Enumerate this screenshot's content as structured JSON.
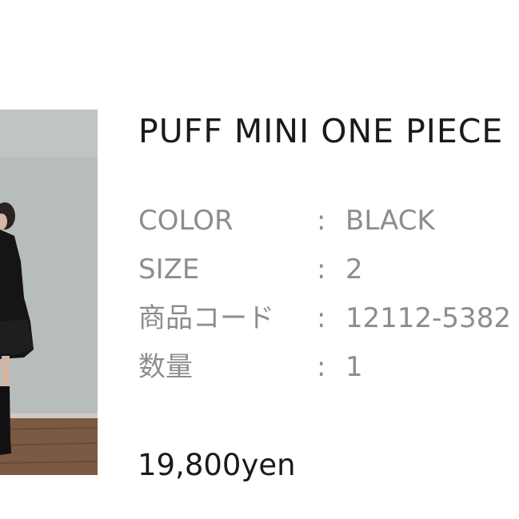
{
  "product": {
    "title": "PUFF MINI ONE PIECE",
    "price": "19,800yen",
    "image_alt": "model-wearing-black-dress"
  },
  "specs": [
    {
      "label": "COLOR",
      "colon": ":",
      "value": "BLACK"
    },
    {
      "label": "SIZE",
      "colon": ":",
      "value": "2"
    },
    {
      "label": "商品コード",
      "colon": ":",
      "value": "12112-5382"
    },
    {
      "label": "数量",
      "colon": ":",
      "value": "1"
    }
  ],
  "colors": {
    "title": "#1a1a1a",
    "spec_text": "#8d8d8d",
    "background": "#ffffff"
  }
}
